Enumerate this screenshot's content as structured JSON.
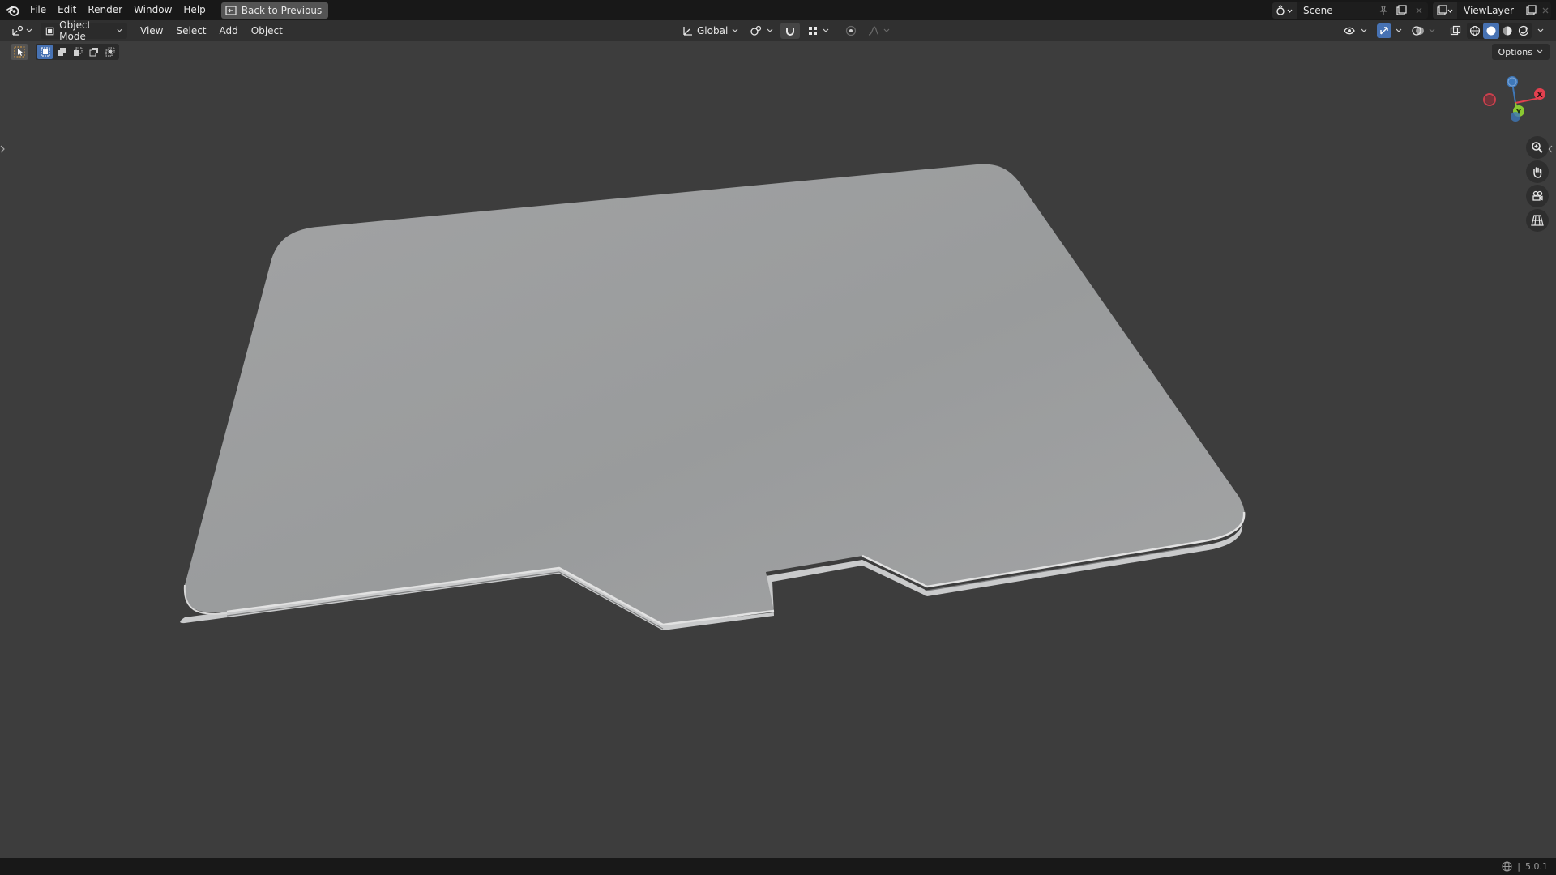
{
  "topbar": {
    "logo": "blender-logo-icon",
    "menus": [
      "File",
      "Edit",
      "Render",
      "Window",
      "Help"
    ],
    "back_button": "Back to Previous",
    "scene": "Scene",
    "view_layer": "ViewLayer"
  },
  "header": {
    "mode": "Object Mode",
    "menus": [
      "View",
      "Select",
      "Add",
      "Object"
    ],
    "orientation": "Global"
  },
  "toolrow": {
    "options": "Options"
  },
  "status": {
    "version": "5.0.1"
  },
  "colors": {
    "axis_x": "#e2404f",
    "axis_y": "#8bc831",
    "axis_z": "#3f78b8",
    "accent": "#4772b3",
    "mesh": "#9c9d9e",
    "background": "#3d3d3d"
  },
  "gizmo": {
    "x_label": "X",
    "y_label": "Y"
  }
}
